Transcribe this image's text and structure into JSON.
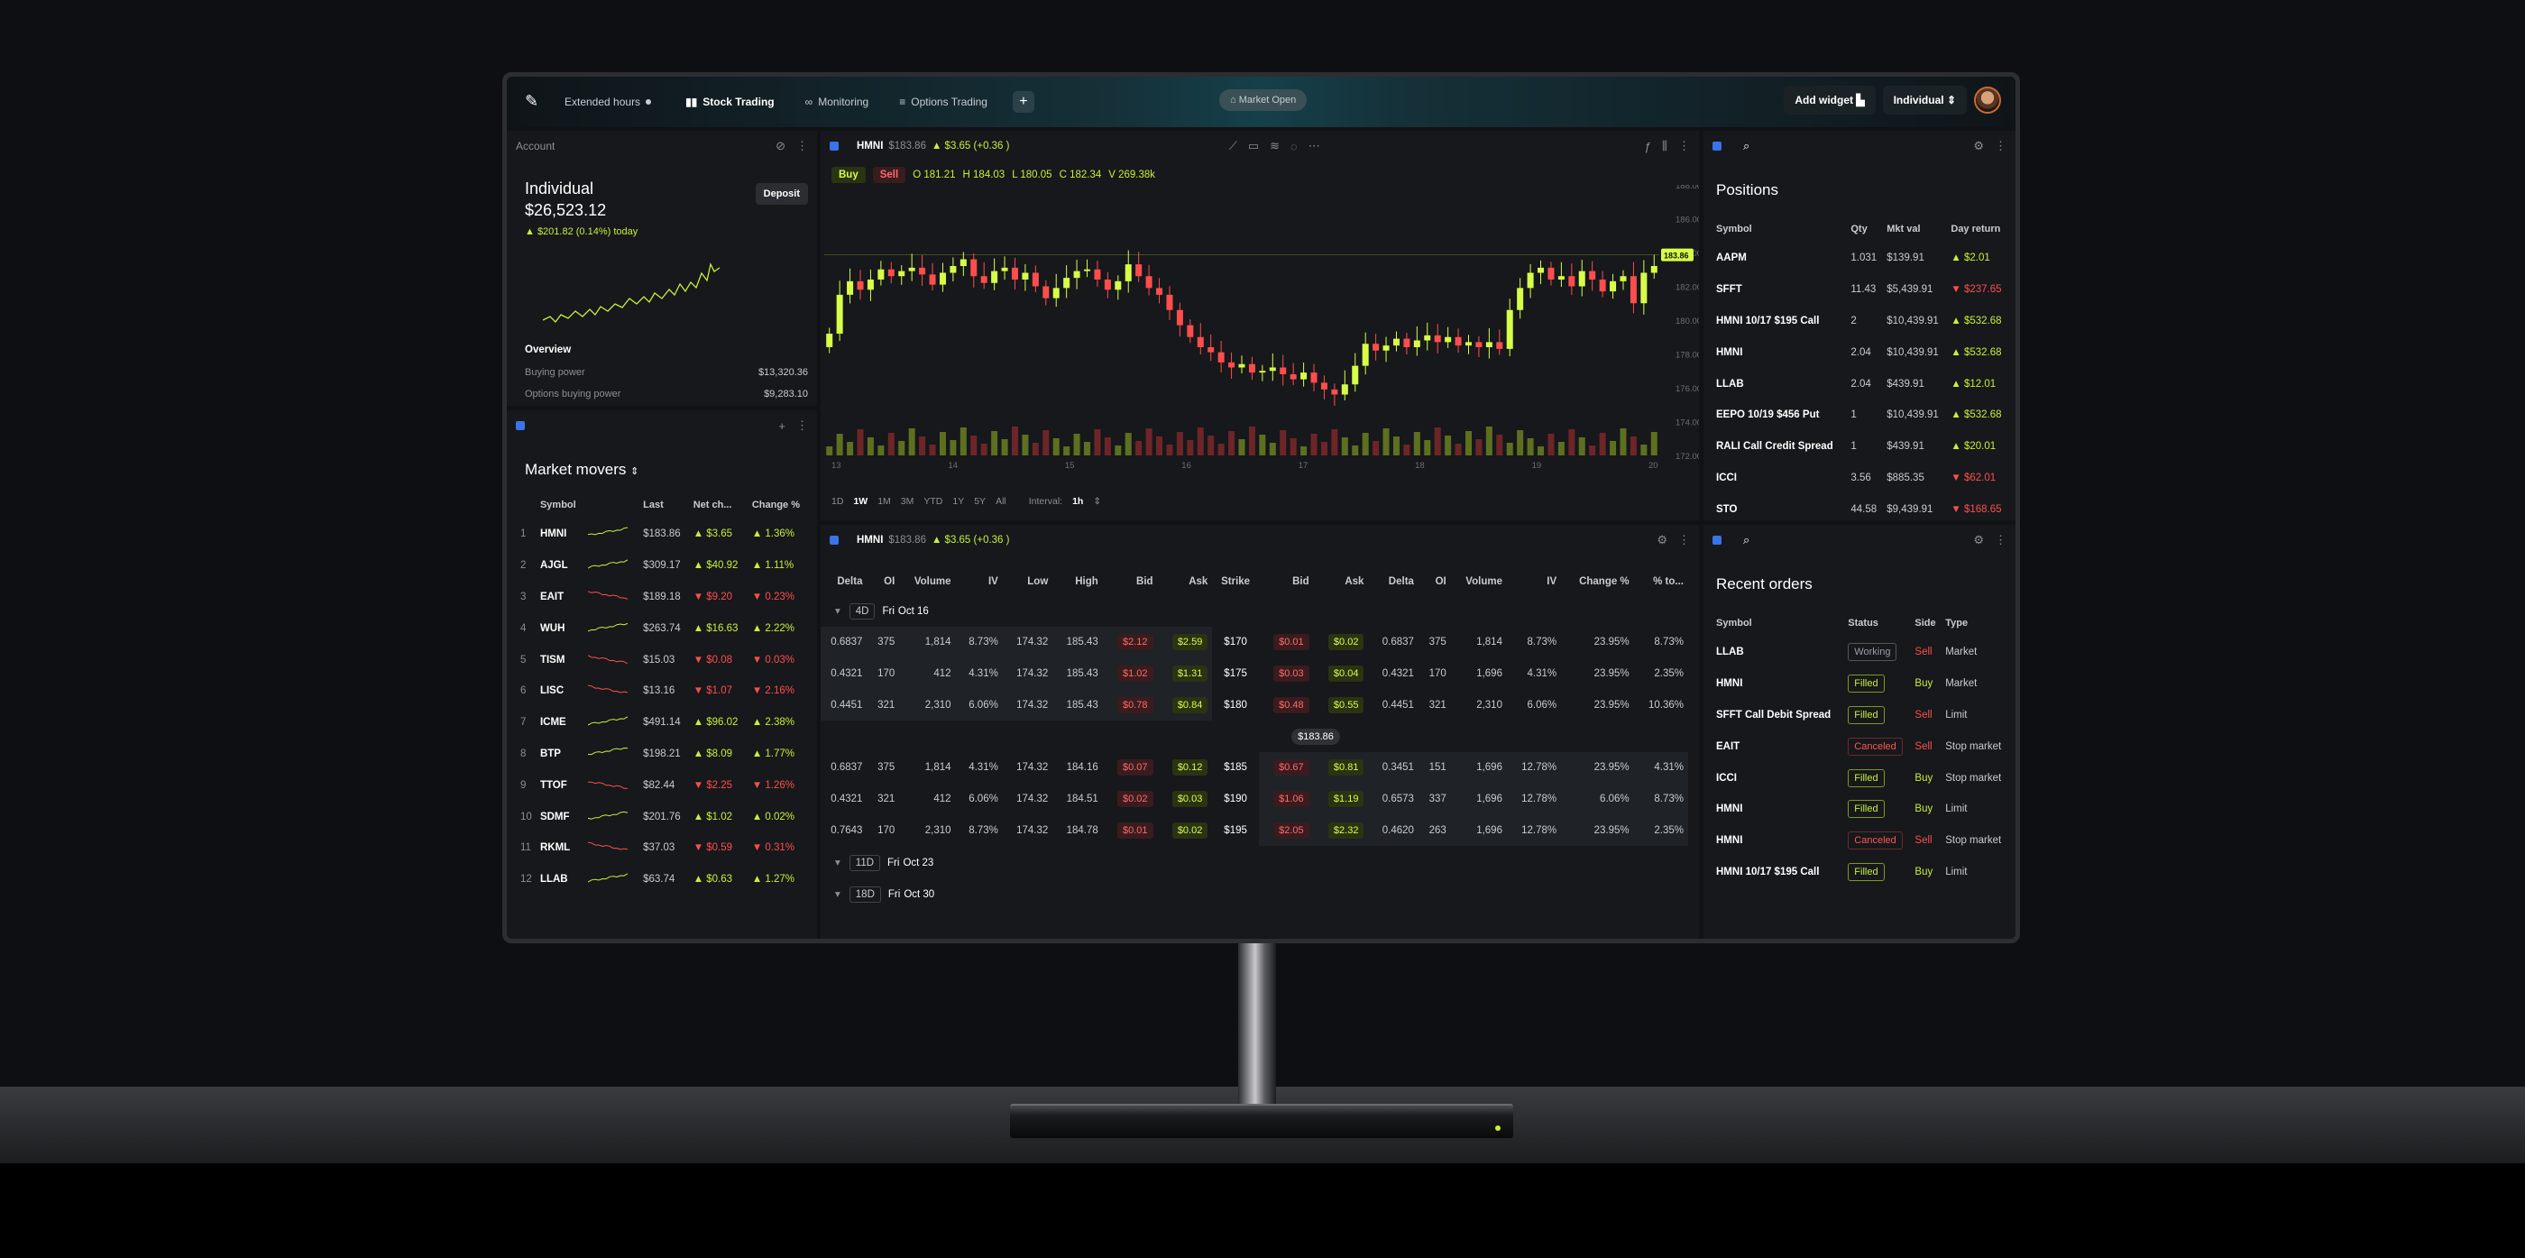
{
  "topbar": {
    "extended_hours": "Extended hours",
    "tabs": [
      "Stock Trading",
      "Monitoring",
      "Options Trading"
    ],
    "market_status": "Market Open",
    "add_widget": "Add widget",
    "account_select": "Individual"
  },
  "account": {
    "header": "Account",
    "deposit": "Deposit",
    "name": "Individual",
    "balance": "$26,523.12",
    "today": "▲ $201.82 (0.14%) today",
    "overview_title": "Overview",
    "buying_power_label": "Buying power",
    "buying_power": "$13,320.36",
    "options_bp_label": "Options buying power",
    "options_bp": "$9,283.10"
  },
  "movers": {
    "title": "Market movers",
    "columns": [
      "Symbol",
      "Last",
      "Net ch...",
      "Change %"
    ],
    "rows": [
      {
        "n": "1",
        "s": "HMNI",
        "last": "$183.86",
        "net": "▲ $3.65",
        "pct": "▲ 1.36%",
        "up": true
      },
      {
        "n": "2",
        "s": "AJGL",
        "last": "$309.17",
        "net": "▲ $40.92",
        "pct": "▲ 1.11%",
        "up": true
      },
      {
        "n": "3",
        "s": "EAIT",
        "last": "$189.18",
        "net": "▼ $9.20",
        "pct": "▼ 0.23%",
        "up": false
      },
      {
        "n": "4",
        "s": "WUH",
        "last": "$263.74",
        "net": "▲ $16.63",
        "pct": "▲ 2.22%",
        "up": true
      },
      {
        "n": "5",
        "s": "TISM",
        "last": "$15.03",
        "net": "▼ $0.08",
        "pct": "▼ 0.03%",
        "up": false
      },
      {
        "n": "6",
        "s": "LISC",
        "last": "$13.16",
        "net": "▼ $1.07",
        "pct": "▼ 2.16%",
        "up": false
      },
      {
        "n": "7",
        "s": "ICME",
        "last": "$491.14",
        "net": "▲ $96.02",
        "pct": "▲ 2.38%",
        "up": true
      },
      {
        "n": "8",
        "s": "BTP",
        "last": "$198.21",
        "net": "▲ $8.09",
        "pct": "▲ 1.77%",
        "up": true
      },
      {
        "n": "9",
        "s": "TTOF",
        "last": "$82.44",
        "net": "▼ $2.25",
        "pct": "▼ 1.26%",
        "up": false
      },
      {
        "n": "10",
        "s": "SDMF",
        "last": "$201.76",
        "net": "▲ $1.02",
        "pct": "▲ 0.02%",
        "up": true
      },
      {
        "n": "11",
        "s": "RKML",
        "last": "$37.03",
        "net": "▼ $0.59",
        "pct": "▼ 0.31%",
        "up": false
      },
      {
        "n": "12",
        "s": "LLAB",
        "last": "$63.74",
        "net": "▲ $0.63",
        "pct": "▲ 1.27%",
        "up": true
      }
    ]
  },
  "chart": {
    "symbol": "HMNI",
    "price": "$183.86",
    "change": "▲ $3.65 (+0.36 )",
    "buy": "Buy",
    "sell": "Sell",
    "o": "O 181.21",
    "h": "H 184.03",
    "l": "L 180.05",
    "c": "C 182.34",
    "v": "V 269.38k",
    "ranges": [
      "1D",
      "1W",
      "1M",
      "3M",
      "YTD",
      "1Y",
      "5Y",
      "All"
    ],
    "interval_label": "Interval:",
    "interval": "1h",
    "last_tag": "183.86",
    "y_ticks": [
      "188.00",
      "186.00",
      "184.00",
      "182.00",
      "180.00",
      "178.00",
      "176.00",
      "174.00",
      "172.00"
    ],
    "x_ticks": [
      "13",
      "14",
      "15",
      "16",
      "17",
      "18",
      "19",
      "20"
    ]
  },
  "chart_data": {
    "type": "candlestick",
    "x_dates": [
      "13",
      "14",
      "15",
      "16",
      "17",
      "18",
      "19",
      "20"
    ],
    "ylim": [
      172,
      188
    ],
    "close": [
      179.2,
      181.5,
      182.3,
      181.8,
      182.4,
      183.0,
      182.6,
      182.9,
      183.1,
      182.7,
      182.1,
      182.8,
      183.2,
      183.6,
      182.6,
      182.2,
      182.9,
      183.1,
      182.4,
      182.8,
      182.0,
      181.3,
      181.9,
      182.5,
      182.9,
      183.0,
      182.4,
      181.8,
      182.3,
      183.3,
      182.6,
      181.9,
      181.5,
      180.6,
      179.7,
      179.0,
      178.4,
      178.1,
      177.5,
      177.2,
      177.4,
      176.9,
      177.0,
      177.2,
      176.8,
      176.5,
      176.9,
      176.3,
      175.9,
      175.6,
      176.2,
      177.3,
      178.6,
      178.2,
      178.5,
      178.9,
      178.4,
      178.8,
      179.1,
      178.7,
      179.0,
      178.5,
      178.7,
      178.4,
      178.7,
      178.3,
      180.6,
      181.9,
      182.8,
      183.1,
      182.4,
      182.6,
      182.0,
      182.9,
      182.4,
      181.7,
      182.3,
      182.6,
      181.0,
      182.8,
      183.2
    ]
  },
  "options": {
    "symbol": "HMNI",
    "price": "$183.86",
    "change": "▲ $3.65 (+0.36 )",
    "columns": [
      "Delta",
      "OI",
      "Volume",
      "IV",
      "Low",
      "High",
      "Bid",
      "Ask",
      "Strike",
      "Bid",
      "Ask",
      "Delta",
      "OI",
      "Volume",
      "IV",
      "Change %",
      "% to..."
    ],
    "expiries": [
      {
        "d": "4D",
        "label": "Fri",
        "date": "Oct 16"
      },
      {
        "d": "11D",
        "label": "Fri",
        "date": "Oct 23"
      },
      {
        "d": "18D",
        "label": "Fri",
        "date": "Oct 30"
      }
    ],
    "marker": "$183.86",
    "rows": [
      [
        "0.6837",
        "375",
        "1,814",
        "8.73%",
        "174.32",
        "185.43",
        "$2.12",
        "$2.59",
        "$170",
        "$0.01",
        "$0.02",
        "0.6837",
        "375",
        "1,814",
        "8.73%",
        "23.95%",
        "8.73%"
      ],
      [
        "0.4321",
        "170",
        "412",
        "4.31%",
        "174.32",
        "185.43",
        "$1.02",
        "$1.31",
        "$175",
        "$0.03",
        "$0.04",
        "0.4321",
        "170",
        "1,696",
        "4.31%",
        "23.95%",
        "2.35%"
      ],
      [
        "0.4451",
        "321",
        "2,310",
        "6.06%",
        "174.32",
        "185.43",
        "$0.78",
        "$0.84",
        "$180",
        "$0.48",
        "$0.55",
        "0.4451",
        "321",
        "2,310",
        "6.06%",
        "23.95%",
        "10.36%"
      ],
      [
        "0.6837",
        "375",
        "1,814",
        "4.31%",
        "174.32",
        "184.16",
        "$0.07",
        "$0.12",
        "$185",
        "$0.67",
        "$0.81",
        "0.3451",
        "151",
        "1,696",
        "12.78%",
        "23.95%",
        "4.31%"
      ],
      [
        "0.4321",
        "321",
        "412",
        "6.06%",
        "174.32",
        "184.51",
        "$0.02",
        "$0.03",
        "$190",
        "$1.06",
        "$1.19",
        "0.6573",
        "337",
        "1,696",
        "12.78%",
        "6.06%",
        "8.73%"
      ],
      [
        "0.7643",
        "170",
        "2,310",
        "8.73%",
        "174.32",
        "184.78",
        "$0.01",
        "$0.02",
        "$195",
        "$2.05",
        "$2.32",
        "0.4620",
        "263",
        "1,696",
        "12.78%",
        "23.95%",
        "2.35%"
      ]
    ]
  },
  "positions": {
    "title": "Positions",
    "columns": [
      "Symbol",
      "Qty",
      "Mkt val",
      "Day return"
    ],
    "rows": [
      {
        "s": "AAPM",
        "q": "1.031",
        "v": "$139.91",
        "r": "▲ $2.01",
        "up": true
      },
      {
        "s": "SFFT",
        "q": "11.43",
        "v": "$5,439.91",
        "r": "▼ $237.65",
        "up": false
      },
      {
        "s": "HMNI 10/17 $195 Call",
        "q": "2",
        "v": "$10,439.91",
        "r": "▲ $532.68",
        "up": true
      },
      {
        "s": "HMNI",
        "q": "2.04",
        "v": "$10,439.91",
        "r": "▲ $532.68",
        "up": true
      },
      {
        "s": "LLAB",
        "q": "2.04",
        "v": "$439.91",
        "r": "▲ $12.01",
        "up": true
      },
      {
        "s": "EEPO 10/19 $456 Put",
        "q": "1",
        "v": "$10,439.91",
        "r": "▲ $532.68",
        "up": true
      },
      {
        "s": "RALI Call Credit Spread",
        "q": "1",
        "v": "$439.91",
        "r": "▲ $20.01",
        "up": true
      },
      {
        "s": "ICCI",
        "q": "3.56",
        "v": "$885.35",
        "r": "▼ $62.01",
        "up": false
      },
      {
        "s": "STO",
        "q": "44.58",
        "v": "$9,439.91",
        "r": "▼ $168.65",
        "up": false
      }
    ]
  },
  "orders": {
    "title": "Recent orders",
    "columns": [
      "Symbol",
      "Status",
      "Side",
      "Type"
    ],
    "rows": [
      {
        "s": "LLAB",
        "st": "Working",
        "side": "Sell",
        "t": "Market"
      },
      {
        "s": "HMNI",
        "st": "Filled",
        "side": "Buy",
        "t": "Market"
      },
      {
        "s": "SFFT Call Debit Spread",
        "st": "Filled",
        "side": "Sell",
        "t": "Limit"
      },
      {
        "s": "EAIT",
        "st": "Canceled",
        "side": "Sell",
        "t": "Stop market"
      },
      {
        "s": "ICCI",
        "st": "Filled",
        "side": "Buy",
        "t": "Stop market"
      },
      {
        "s": "HMNI",
        "st": "Filled",
        "side": "Buy",
        "t": "Limit"
      },
      {
        "s": "HMNI",
        "st": "Canceled",
        "side": "Sell",
        "t": "Stop market"
      },
      {
        "s": "HMNI 10/17 $195 Call",
        "st": "Filled",
        "side": "Buy",
        "t": "Limit"
      }
    ]
  }
}
